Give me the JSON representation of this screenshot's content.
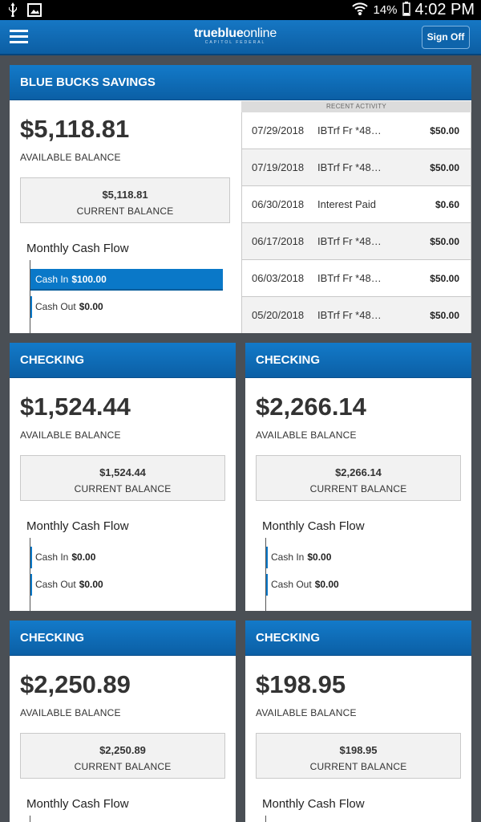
{
  "status": {
    "battery": "14%",
    "time": "4:02 PM"
  },
  "app": {
    "logo_bold": "trueblue",
    "logo_light": "online",
    "logo_sub": "CAPITOL FEDERAL",
    "signoff": "Sign Off"
  },
  "savings": {
    "title": "BLUE BUCKS SAVINGS",
    "available": "$5,118.81",
    "available_label": "AVAILABLE BALANCE",
    "current": "$5,118.81",
    "current_label": "CURRENT BALANCE",
    "mcf_title": "Monthly Cash Flow",
    "cash_in_label": "Cash In",
    "cash_in": "$100.00",
    "cash_out_label": "Cash Out",
    "cash_out": "$0.00",
    "recent_header": "RECENT ACTIVITY",
    "activity": [
      {
        "date": "07/29/2018",
        "desc": "IBTrf Fr *48…",
        "amount": "$50.00"
      },
      {
        "date": "07/19/2018",
        "desc": "IBTrf Fr *48…",
        "amount": "$50.00"
      },
      {
        "date": "06/30/2018",
        "desc": "Interest Paid",
        "amount": "$0.60"
      },
      {
        "date": "06/17/2018",
        "desc": "IBTrf Fr *48…",
        "amount": "$50.00"
      },
      {
        "date": "06/03/2018",
        "desc": "IBTrf Fr *48…",
        "amount": "$50.00"
      },
      {
        "date": "05/20/2018",
        "desc": "IBTrf Fr *48…",
        "amount": "$50.00"
      }
    ]
  },
  "checking": [
    {
      "title": "CHECKING",
      "available": "$1,524.44",
      "available_label": "AVAILABLE BALANCE",
      "current": "$1,524.44",
      "current_label": "CURRENT BALANCE",
      "mcf_title": "Monthly Cash Flow",
      "cash_in_label": "Cash In",
      "cash_in": "$0.00",
      "cash_out_label": "Cash Out",
      "cash_out": "$0.00"
    },
    {
      "title": "CHECKING",
      "available": "$2,266.14",
      "available_label": "AVAILABLE BALANCE",
      "current": "$2,266.14",
      "current_label": "CURRENT BALANCE",
      "mcf_title": "Monthly Cash Flow",
      "cash_in_label": "Cash In",
      "cash_in": "$0.00",
      "cash_out_label": "Cash Out",
      "cash_out": "$0.00"
    },
    {
      "title": "CHECKING",
      "available": "$2,250.89",
      "available_label": "AVAILABLE BALANCE",
      "current": "$2,250.89",
      "current_label": "CURRENT BALANCE",
      "mcf_title": "Monthly Cash Flow"
    },
    {
      "title": "CHECKING",
      "available": "$198.95",
      "available_label": "AVAILABLE BALANCE",
      "current": "$198.95",
      "current_label": "CURRENT BALANCE",
      "mcf_title": "Monthly Cash Flow"
    }
  ],
  "colors": {
    "brand_blue": "#0c68b4",
    "background": "#4a4f55"
  }
}
